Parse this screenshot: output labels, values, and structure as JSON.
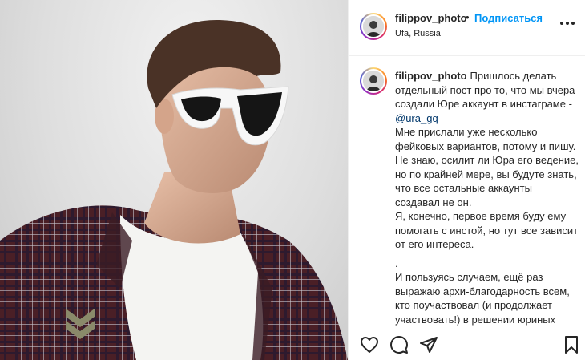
{
  "post": {
    "username": "filippov_photo",
    "location": "Ufa, Russia",
    "follow_label": "Подписаться",
    "dot": "•"
  },
  "caption": {
    "username": "filippov_photo",
    "line1": "Пришлось делать отдельный пост про то, что мы вчера создали Юре аккаунт в инстаграме - ",
    "mention": "@ura_gq",
    "para2": "Мне прислали уже несколько фейковых вариантов, потому и пишу.",
    "para3": "Не знаю, осилит ли Юра его ведение, но по крайней мере, вы будуте знать, что все остальные аккаунты создавал не он.",
    "para4": "Я, конечно, первое время буду ему помогать с инстой, но тут все зависит от его интереса.",
    "para5": ".",
    "para6": "И пользуясь случаем, ещё раз выражаю архи-благодарность всем, кто поучаствовал (и продолжает участвовать!) в решении юриных проблем и улучшении его жизни. Вы"
  },
  "icons": {
    "like": "heart-icon",
    "comment": "comment-icon",
    "share": "share-icon",
    "save": "bookmark-icon",
    "more": "more-options-icon"
  },
  "colors": {
    "accent": "#0095f6",
    "text": "#262626",
    "mention": "#00376b",
    "border": "#efefef"
  }
}
